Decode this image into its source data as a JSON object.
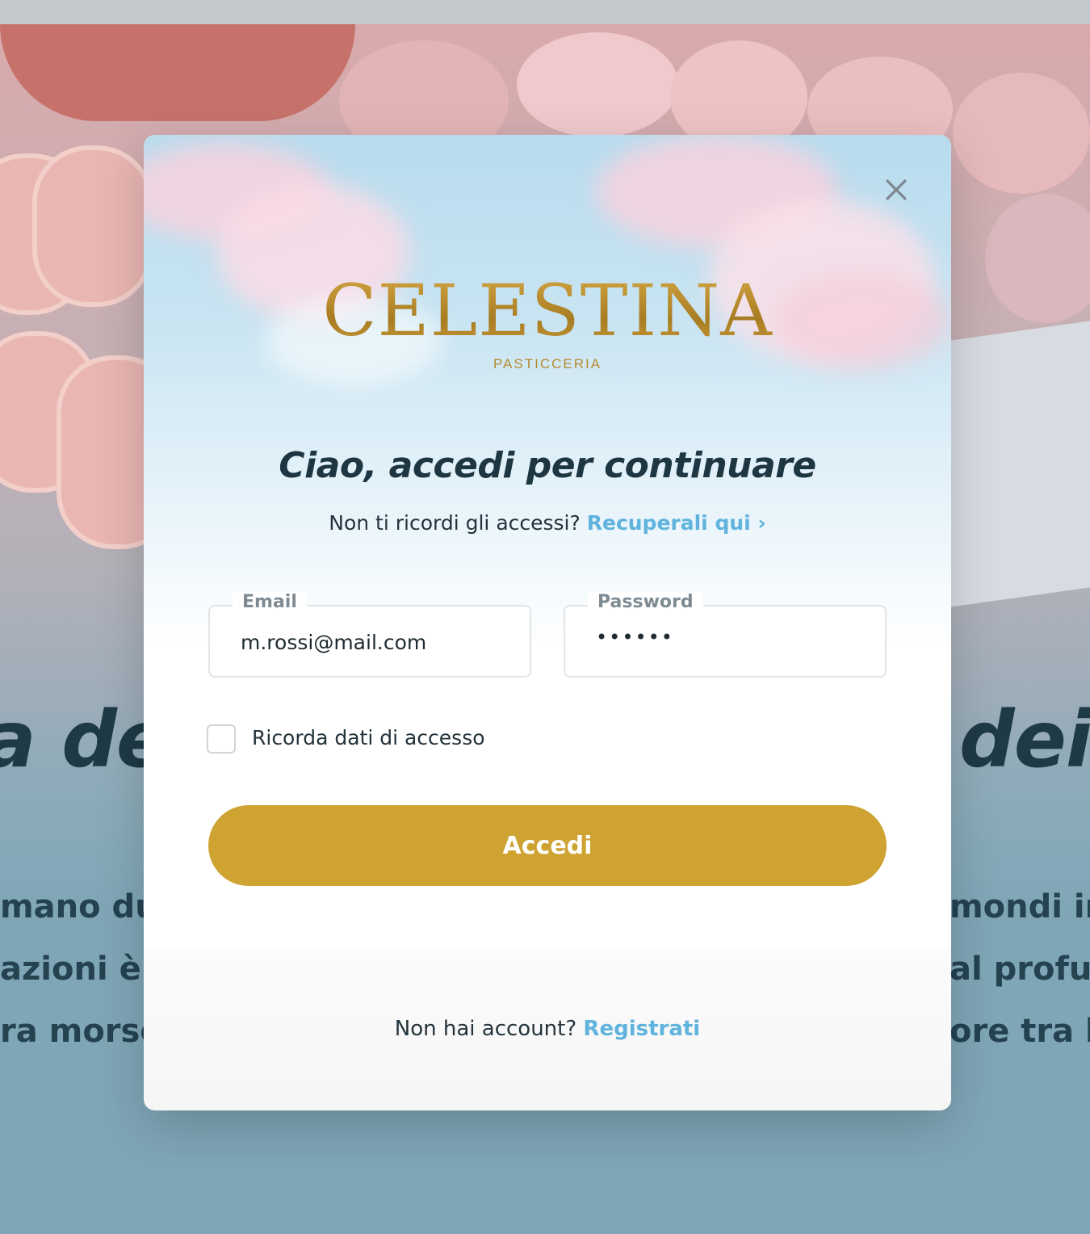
{
  "background": {
    "heading_left": "a de",
    "heading_right": "dei",
    "lines_left": [
      "mano due",
      "azioni è f",
      "ra morso"
    ],
    "lines_right": [
      "mondi in",
      "al profum",
      "ore tra le"
    ]
  },
  "modal": {
    "close_icon": "close-icon",
    "logo": {
      "name": "CELESTINA",
      "subtitle": "PASTICCERIA"
    },
    "title": "Ciao, accedi per continuare",
    "recover": {
      "text": "Non ti ricordi gli accessi?",
      "link": "Recuperali qui ›"
    },
    "email": {
      "label": "Email",
      "value": "m.rossi@mail.com"
    },
    "password": {
      "label": "Password",
      "value": "••••••"
    },
    "remember": {
      "label": "Ricorda dati di accesso",
      "checked": false
    },
    "submit_label": "Accedi",
    "signup": {
      "text": "Non hai account?",
      "link": "Registrati"
    }
  },
  "colors": {
    "accent_gold": "#cea332",
    "link_blue": "#5fb3dd",
    "text_dark": "#1d3641"
  }
}
